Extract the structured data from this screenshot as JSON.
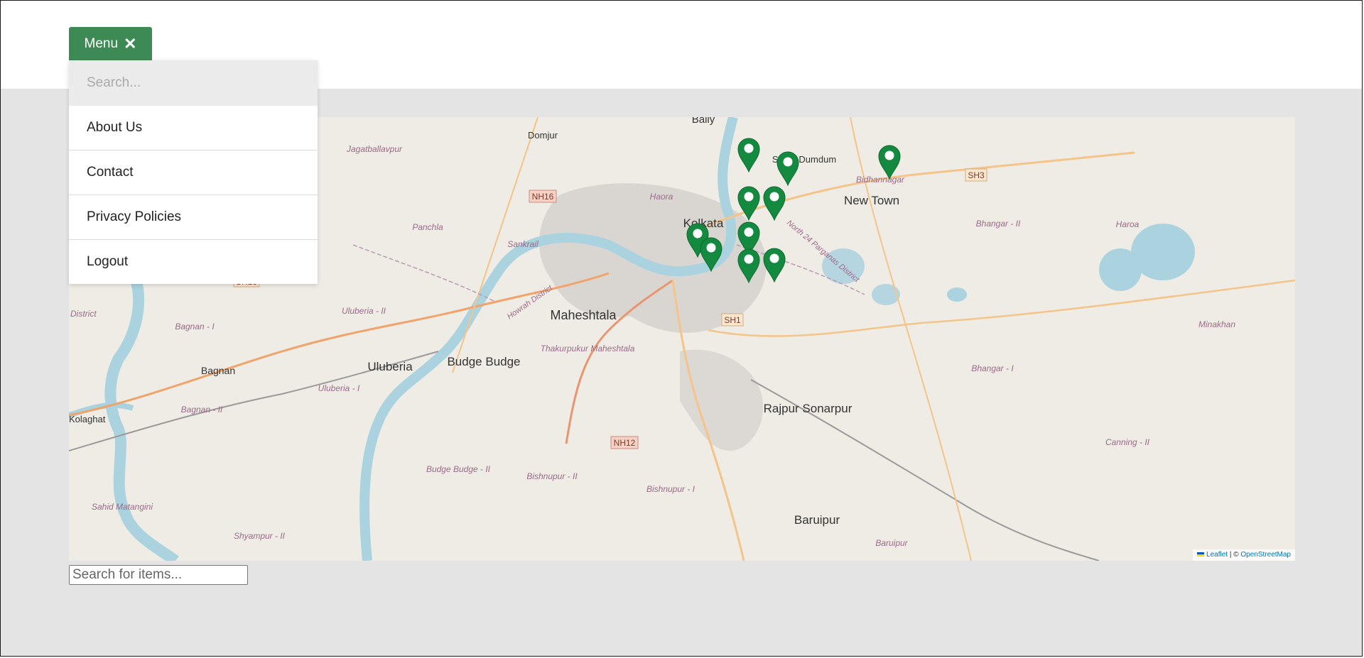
{
  "menu": {
    "button_label": "Menu",
    "close_glyph": "✕",
    "search_placeholder": "Search...",
    "items": [
      {
        "label": "About Us"
      },
      {
        "label": "Contact"
      },
      {
        "label": "Privacy Policies"
      },
      {
        "label": "Logout"
      }
    ]
  },
  "map": {
    "attribution_leaflet": "Leaflet",
    "attribution_sep": " | © ",
    "attribution_osm": "OpenStreetMap",
    "places_large": [
      "Kolkata",
      "New Town",
      "Maheshtala",
      "Budge Budge",
      "Uluberia",
      "Rajpur Sonarpur",
      "Baruipur",
      "Bagnan",
      "Bally",
      "South Dumdum"
    ],
    "places_small": [
      "Domjur",
      "Jagatballavpur",
      "Panchla",
      "Sankrail",
      "Haora",
      "Bidhannagar",
      "Bhangar - II",
      "Haroa",
      "Minakhan",
      "Bhangar - I",
      "Canning - II",
      "Baruipur",
      "Bishnupur - I",
      "Bishnupur - II",
      "Budge Budge - II",
      "Thakurpukur Maheshtala",
      "Uluberia - II",
      "Uluberia - I",
      "Bagnan - I",
      "Bagnan - II",
      "Sahid Matangini",
      "Shyampur - II",
      "Kolaghat",
      "District",
      "Howrah District",
      "North 24 Parganas District"
    ],
    "roads": [
      "NH16",
      "NH12",
      "SH1",
      "SH3",
      "SH13"
    ],
    "marker_color": "#138a3f",
    "marker_count": 11
  },
  "items_search": {
    "placeholder": "Search for items..."
  }
}
